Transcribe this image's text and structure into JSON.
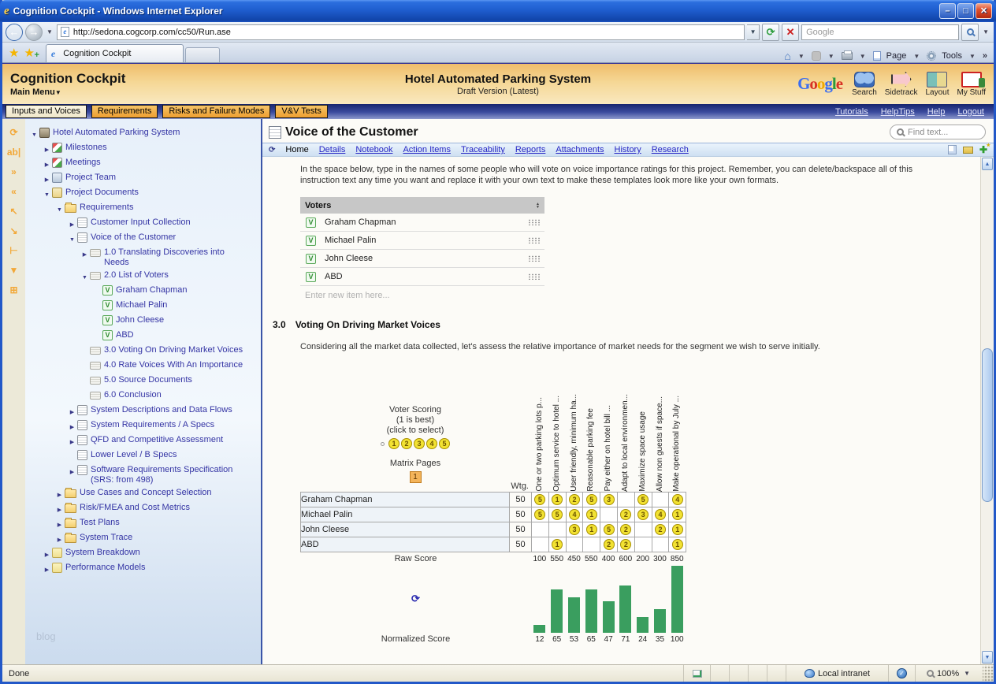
{
  "browser": {
    "title": "Cognition Cockpit - Windows Internet Explorer",
    "url": "http://sedona.cogcorp.com/cc50/Run.ase",
    "tab": "Cognition Cockpit",
    "search_placeholder": "Google",
    "toolbar": {
      "page": "Page",
      "tools": "Tools"
    },
    "status": {
      "done": "Done",
      "zone": "Local intranet",
      "zoom": "100%"
    }
  },
  "header": {
    "app_title": "Cognition Cockpit",
    "main_menu": "Main Menu",
    "project_title": "Hotel Automated Parking System",
    "project_subtitle": "Draft Version (Latest)",
    "google_logo": "Google",
    "tools": [
      {
        "label": "Search"
      },
      {
        "label": "Sidetrack"
      },
      {
        "label": "Layout"
      },
      {
        "label": "My Stuff"
      }
    ]
  },
  "navbar": {
    "tabs": [
      {
        "label": "Inputs and Voices",
        "active": true
      },
      {
        "label": "Requirements",
        "active": false
      },
      {
        "label": "Risks and Failure Modes",
        "active": false
      },
      {
        "label": "V&V Tests",
        "active": false
      }
    ],
    "links": [
      "Tutorials",
      "HelpTips",
      "Help",
      "Logout"
    ]
  },
  "sidebar": {
    "watermark": "blog",
    "tool_icons": [
      "refresh",
      "rename",
      "expand-all",
      "collapse-all",
      "promote",
      "demote",
      "tree",
      "filter",
      "tree-grid"
    ],
    "tree": [
      {
        "level": 0,
        "exp": "open",
        "icon": "building",
        "label": "Hotel Automated Parking System"
      },
      {
        "level": 1,
        "exp": "closed",
        "icon": "flag",
        "label": "Milestones"
      },
      {
        "level": 1,
        "exp": "closed",
        "icon": "flag",
        "label": "Meetings"
      },
      {
        "level": 1,
        "exp": "closed",
        "icon": "people",
        "label": "Project Team"
      },
      {
        "level": 1,
        "exp": "open",
        "icon": "doc2",
        "label": "Project Documents"
      },
      {
        "level": 2,
        "exp": "open",
        "icon": "folder",
        "label": "Requirements"
      },
      {
        "level": 3,
        "exp": "closed",
        "icon": "doc",
        "label": "Customer Input Collection"
      },
      {
        "level": 3,
        "exp": "open",
        "icon": "doc",
        "label": "Voice of the Customer"
      },
      {
        "level": 4,
        "exp": "closed",
        "icon": "section",
        "label": "1.0 Translating Discoveries into Needs"
      },
      {
        "level": 4,
        "exp": "open",
        "icon": "section",
        "label": "2.0 List of Voters"
      },
      {
        "level": 5,
        "exp": "none",
        "icon": "v",
        "label": "Graham Chapman"
      },
      {
        "level": 5,
        "exp": "none",
        "icon": "v",
        "label": "Michael Palin"
      },
      {
        "level": 5,
        "exp": "none",
        "icon": "v",
        "label": "John Cleese"
      },
      {
        "level": 5,
        "exp": "none",
        "icon": "v",
        "label": "ABD"
      },
      {
        "level": 4,
        "exp": "none",
        "icon": "section",
        "label": "3.0 Voting On Driving Market Voices"
      },
      {
        "level": 4,
        "exp": "none",
        "icon": "section",
        "label": "4.0 Rate Voices With An Importance"
      },
      {
        "level": 4,
        "exp": "none",
        "icon": "section",
        "label": "5.0 Source Documents"
      },
      {
        "level": 4,
        "exp": "none",
        "icon": "section",
        "label": "6.0 Conclusion"
      },
      {
        "level": 3,
        "exp": "closed",
        "icon": "doc",
        "label": "System Descriptions and Data Flows"
      },
      {
        "level": 3,
        "exp": "closed",
        "icon": "doc",
        "label": "System Requirements / A Specs"
      },
      {
        "level": 3,
        "exp": "closed",
        "icon": "doc",
        "label": "QFD and Competitive Assessment"
      },
      {
        "level": 3,
        "exp": "none",
        "icon": "doc",
        "label": "Lower Level / B Specs"
      },
      {
        "level": 3,
        "exp": "closed",
        "icon": "doc",
        "label": "Software Requirements Specification (SRS: from 498)"
      },
      {
        "level": 2,
        "exp": "closed",
        "icon": "folder",
        "label": "Use Cases and Concept Selection"
      },
      {
        "level": 2,
        "exp": "closed",
        "icon": "folder",
        "label": "Risk/FMEA and Cost Metrics"
      },
      {
        "level": 2,
        "exp": "closed",
        "icon": "folder",
        "label": "Test Plans"
      },
      {
        "level": 2,
        "exp": "closed",
        "icon": "folder",
        "label": "System Trace"
      },
      {
        "level": 1,
        "exp": "closed",
        "icon": "ydoc",
        "label": "System Breakdown"
      },
      {
        "level": 1,
        "exp": "closed",
        "icon": "ydoc",
        "label": "Performance Models"
      }
    ]
  },
  "main": {
    "page_title": "Voice of the Customer",
    "find_placeholder": "Find text...",
    "menu": {
      "current": "Home",
      "links": [
        "Details",
        "Notebook",
        "Action Items",
        "Traceability",
        "Reports",
        "Attachments",
        "History",
        "Research"
      ]
    },
    "instructions": "In the space below, type in the names of some people who will vote on voice importance ratings for this project. Remember, you can delete/backspace all of this instruction text any time you want and replace it with your own text to make these templates look more like your own formats.",
    "voters_table": {
      "header": "Voters",
      "rows": [
        "Graham Chapman",
        "Michael Palin",
        "John Cleese",
        "ABD"
      ],
      "new_item_placeholder": "Enter new item here..."
    },
    "section3": {
      "number": "3.0",
      "title": "Voting On Driving Market Voices",
      "description": "Considering all the market data collected, let's assess the relative importance of market needs for the segment we wish to serve initially."
    },
    "scoring": {
      "title": "Voter Scoring",
      "line2": "(1 is best)",
      "line3": "(click to select)",
      "options": [
        "1",
        "2",
        "3",
        "4",
        "5"
      ],
      "matrix_pages_label": "Matrix Pages",
      "matrix_page": "1",
      "wtg_label": "Wtg."
    }
  },
  "chart_data": {
    "type": "bar",
    "title": "3.0 Voting On Driving Market Voices",
    "categories": [
      "One or two parking lots p...",
      "Optimum service to hotel ...",
      "User friendly, minimum ha...",
      "Reasonable parking fee",
      "Pay either on hotel bill ...",
      "Adapt to local environmen...",
      "Maximize space usage",
      "Allow non guests if space...",
      "Make operational by July ..."
    ],
    "voter_rows": [
      {
        "name": "Graham Chapman",
        "wtg": 50,
        "scores": [
          5,
          1,
          2,
          5,
          3,
          null,
          5,
          null,
          4
        ]
      },
      {
        "name": "Michael Palin",
        "wtg": 50,
        "scores": [
          5,
          5,
          4,
          1,
          null,
          2,
          3,
          4,
          1
        ]
      },
      {
        "name": "John Cleese",
        "wtg": 50,
        "scores": [
          null,
          null,
          3,
          1,
          5,
          2,
          null,
          2,
          1
        ]
      },
      {
        "name": "ABD",
        "wtg": 50,
        "scores": [
          null,
          1,
          null,
          null,
          2,
          2,
          null,
          null,
          1
        ]
      }
    ],
    "series": [
      {
        "name": "Raw Score",
        "values": [
          100,
          550,
          450,
          550,
          400,
          600,
          200,
          300,
          850
        ]
      },
      {
        "name": "Normalized Score",
        "values": [
          12,
          65,
          53,
          65,
          47,
          71,
          24,
          35,
          100
        ]
      }
    ],
    "bar_series": "Normalized Score",
    "bar_color": "#3a9e5f",
    "ylim": [
      0,
      100
    ],
    "legend_position": "none",
    "grid": false
  }
}
